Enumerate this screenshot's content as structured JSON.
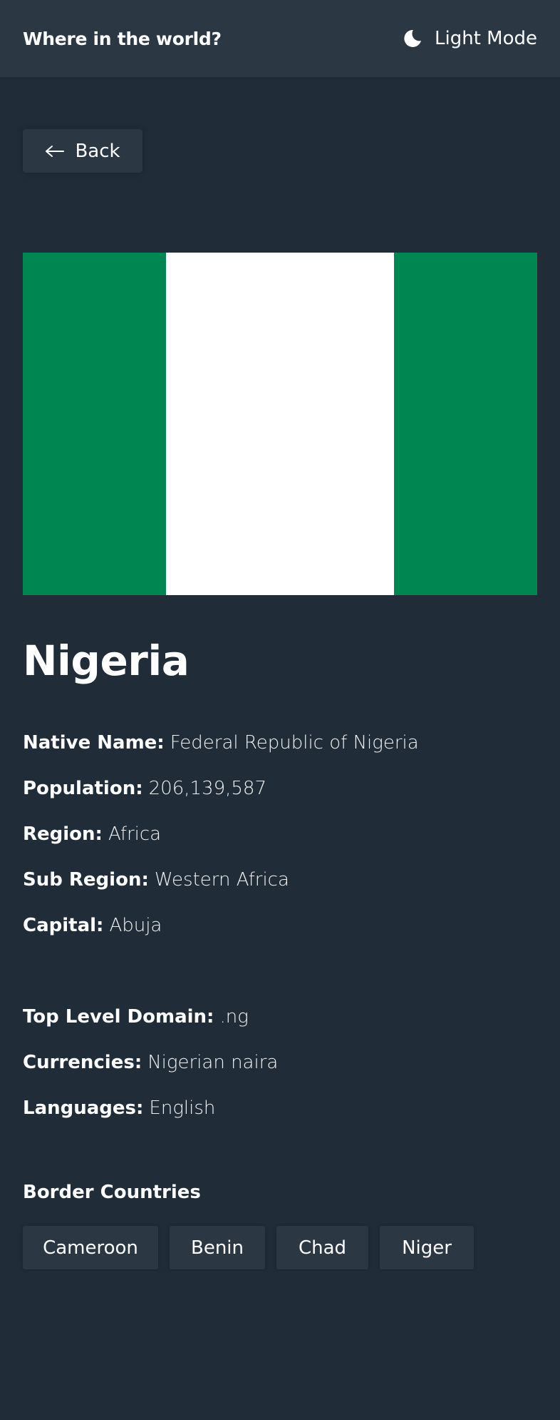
{
  "header": {
    "title": "Where in the world?",
    "theme_label": "Light Mode",
    "theme_icon": "moon-icon"
  },
  "back": {
    "label": "Back",
    "icon": "arrow-left-icon"
  },
  "country": {
    "name": "Nigeria",
    "flag": {
      "colors": [
        "#008751",
        "#ffffff",
        "#008751"
      ]
    },
    "primary_info": [
      {
        "label": "Native Name:",
        "value": "Federal Republic of Nigeria"
      },
      {
        "label": "Population:",
        "value": "206,139,587"
      },
      {
        "label": "Region:",
        "value": "Africa"
      },
      {
        "label": "Sub Region:",
        "value": "Western Africa"
      },
      {
        "label": "Capital:",
        "value": "Abuja"
      }
    ],
    "secondary_info": [
      {
        "label": "Top Level Domain:",
        "value": ".ng"
      },
      {
        "label": "Currencies:",
        "value": "Nigerian naira"
      },
      {
        "label": "Languages:",
        "value": "English"
      }
    ],
    "border_title": "Border Countries",
    "borders": [
      "Cameroon",
      "Benin",
      "Chad",
      "Niger"
    ]
  },
  "colors": {
    "background": "#202c37",
    "element": "#2b3743",
    "text": "#ffffff"
  }
}
